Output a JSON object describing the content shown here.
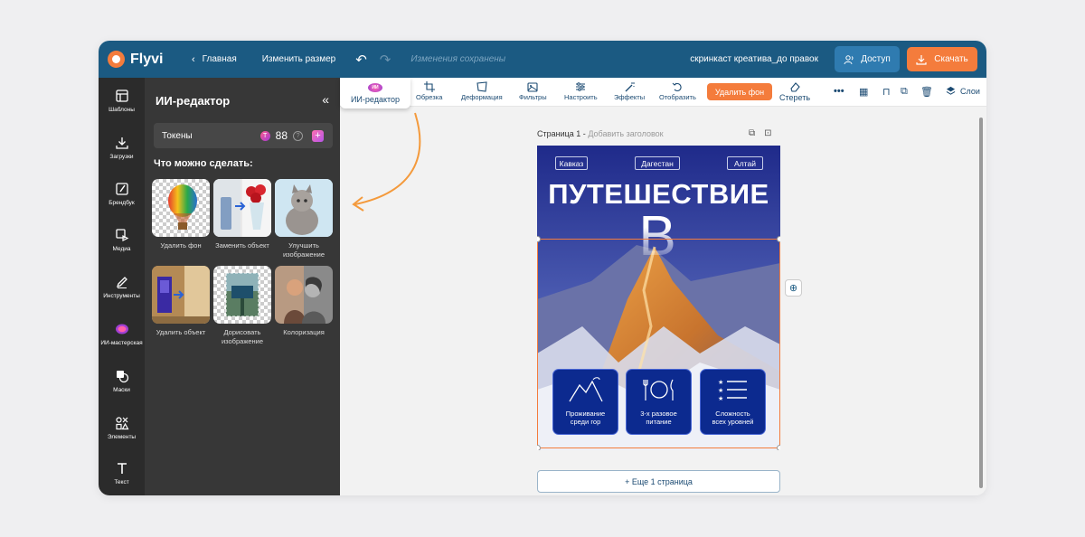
{
  "header": {
    "logo": "Flyvi",
    "home": "Главная",
    "resize": "Изменить размер",
    "saved": "Изменения сохранены",
    "doc_name": "скринкаст креатива_до правок",
    "access": "Доступ",
    "download": "Скачать"
  },
  "rail": [
    {
      "label": "Шаблоны",
      "icon": "templates-icon"
    },
    {
      "label": "Загрузки",
      "icon": "upload-icon"
    },
    {
      "label": "Брендбук",
      "icon": "brandbook-icon"
    },
    {
      "label": "Медиа",
      "icon": "media-icon"
    },
    {
      "label": "Инструменты",
      "icon": "pen-icon"
    },
    {
      "label": "ИИ-мастерская",
      "icon": "ai-workshop-icon"
    },
    {
      "label": "Маски",
      "icon": "mask-icon"
    },
    {
      "label": "Элементы",
      "icon": "elements-icon"
    },
    {
      "label": "Текст",
      "icon": "text-icon"
    }
  ],
  "panel": {
    "title": "ИИ-редактор",
    "collapse": "«",
    "tokens_label": "Токены",
    "tokens_count": "88",
    "section": "Что можно сделать:",
    "features": [
      {
        "label": "Удалить фон"
      },
      {
        "label": "Заменить объект"
      },
      {
        "label": "Улучшить изображение"
      },
      {
        "label": "Удалить объект"
      },
      {
        "label": "Дорисовать изображение"
      },
      {
        "label": "Колоризация"
      }
    ]
  },
  "toolbar": {
    "ai_editor": "ИИ-редактор",
    "ai_badge": "ИИ",
    "tools": [
      "Обрезка",
      "Деформация",
      "Фильтры",
      "Настроить",
      "Эффекты",
      "Отобразить"
    ],
    "remove_bg": "Удалить фон",
    "erase": "Стереть",
    "layers": "Слои"
  },
  "canvas": {
    "page_label": "Страница 1 -",
    "add_title": "Добавить заголовок",
    "more_pages": "+ Еще 1 страница"
  },
  "design": {
    "tags": [
      "Кавказ",
      "Дагестан",
      "Алтай"
    ],
    "title_line1": "ПУТЕШЕСТВИЕ",
    "title_line2": "В ГОРАХ",
    "cards": [
      {
        "line1": "Проживание",
        "line2": "среди гор"
      },
      {
        "line1": "3-х разовое",
        "line2": "питание"
      },
      {
        "line1": "Сложность",
        "line2": "всех уровней"
      }
    ]
  },
  "colors": {
    "header": "#1b5a82",
    "accent": "#f47c3c",
    "rail": "#2b2b2b",
    "panel": "#373737",
    "canvas_bg": "#f2f2f2"
  }
}
